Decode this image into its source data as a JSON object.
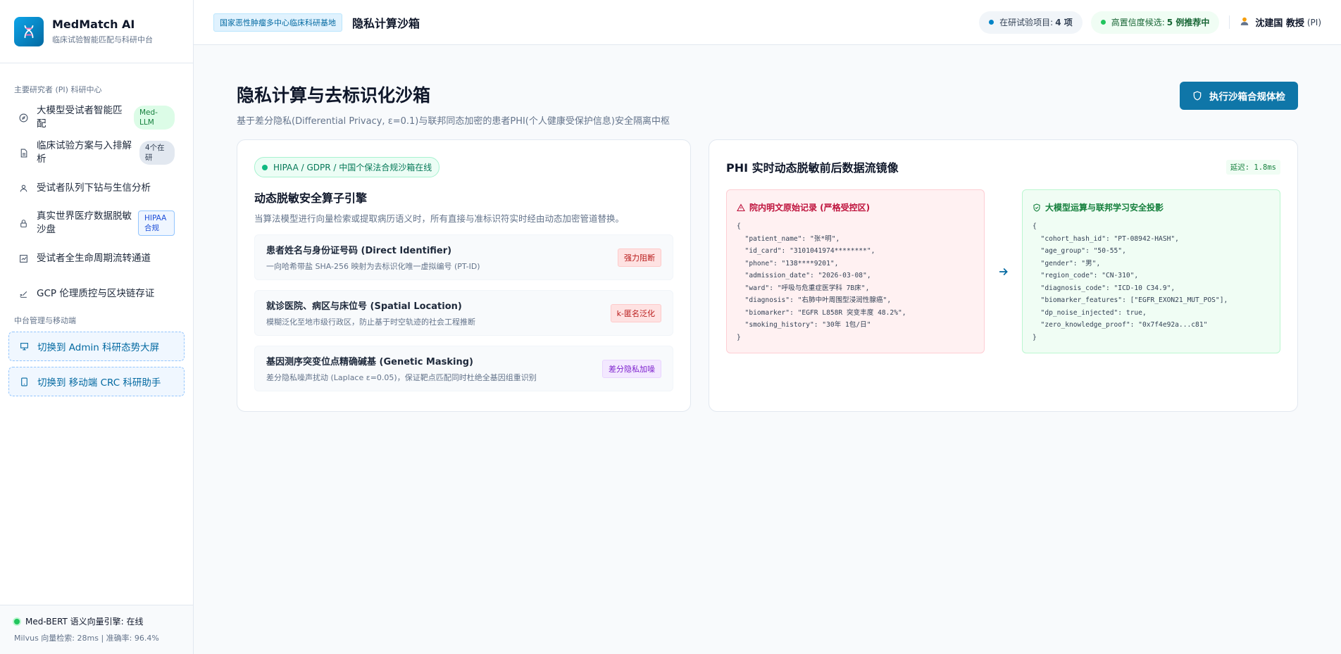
{
  "brand": {
    "name": "MedMatch AI",
    "subtitle": "临床试验智能匹配与科研中台"
  },
  "sidebar": {
    "section_pi": "主要研究者 (PI) 科研中心",
    "items": [
      {
        "label": "大模型受试者智能匹配",
        "badge": "Med-LLM",
        "icon": "compass-icon"
      },
      {
        "label": "临床试验方案与入排解析",
        "badge": "4个在研",
        "icon": "document-icon"
      },
      {
        "label": "受试者队列下钻与生信分析",
        "icon": "user-icon"
      },
      {
        "label": "真实世界医疗数据脱敏沙盘",
        "badge": "HIPAA合规",
        "icon": "lock-icon"
      },
      {
        "label": "受试者全生命周期流转通道",
        "icon": "chart-icon"
      },
      {
        "label": "GCP 伦理质控与区块链存证",
        "icon": "signature-icon"
      }
    ],
    "section_admin": "中台管理与移动端",
    "switches": [
      {
        "label": "切换到 Admin 科研态势大屏",
        "icon": "presentation-icon"
      },
      {
        "label": "切换到 移动端 CRC 科研助手",
        "icon": "tablet-icon"
      }
    ],
    "footer": {
      "status": "Med-BERT 语义向量引擎: 在线",
      "metrics": "Milvus 向量检索: 28ms | 准确率: 96.4%"
    }
  },
  "header": {
    "tag": "国家恶性肿瘤多中心临床科研基地",
    "title": "隐私计算沙箱",
    "projects_label": "在研试验项目:",
    "projects_value": "4 项",
    "candidates_label": "高置信度候选:",
    "candidates_value": "5 例推荐中",
    "user_name": "沈建国 教授",
    "user_role": "(PI)"
  },
  "page": {
    "title": "隐私计算与去标识化沙箱",
    "subtitle": "基于差分隐私(Differential Privacy, ε=0.1)与联邦同态加密的患者PHI(个人健康受保护信息)安全隔离中枢",
    "action_button": "执行沙箱合规体检"
  },
  "engine_card": {
    "badge": "HIPAA / GDPR / 中国个保法合规沙箱在线",
    "title": "动态脱敏安全算子引擎",
    "description": "当算法模型进行向量检索或提取病历语义时，所有直接与准标识符实时经由动态加密管道替换。",
    "rules": [
      {
        "title": "患者姓名与身份证号码 (Direct Identifier)",
        "desc": "一向哈希带盐 SHA-256 映射为去标识化唯一虚拟编号 (PT-ID)",
        "tag": "强力阻断",
        "tag_style": "red"
      },
      {
        "title": "就诊医院、病区与床位号 (Spatial Location)",
        "desc": "模糊泛化至地市级行政区，防止基于时空轨迹的社会工程推断",
        "tag": "k-匿名泛化",
        "tag_style": "red"
      },
      {
        "title": "基因测序突变位点精确碱基 (Genetic Masking)",
        "desc": "差分隐私噪声扰动 (Laplace ε=0.05)，保证靶点匹配同时杜绝全基因组重识别",
        "tag": "差分隐私加噪",
        "tag_style": "purple"
      }
    ]
  },
  "mirror_card": {
    "title": "PHI 实时动态脱敏前后数据流镜像",
    "latency": "延迟: 1.8ms",
    "raw_title": "院内明文原始记录 (严格受控区)",
    "raw_code": "{\n  \"patient_name\": \"张*明\",\n  \"id_card\": \"3101041974********\",\n  \"phone\": \"138****9201\",\n  \"admission_date\": \"2026-03-08\",\n  \"ward\": \"呼吸与危重症医学科 7B床\",\n  \"diagnosis\": \"右肺中叶周围型浸润性腺癌\",\n  \"biomarker\": \"EGFR L858R 突变丰度 48.2%\",\n  \"smoking_history\": \"30年 1包/日\"\n}",
    "safe_title": "大模型运算与联邦学习安全投影",
    "safe_code": "{\n  \"cohort_hash_id\": \"PT-08942-HASH\",\n  \"age_group\": \"50-55\",\n  \"gender\": \"男\",\n  \"region_code\": \"CN-310\",\n  \"diagnosis_code\": \"ICD-10 C34.9\",\n  \"biomarker_features\": [\"EGFR_EXON21_MUT_POS\"],\n  \"dp_noise_injected\": true,\n  \"zero_knowledge_proof\": \"0x7f4e92a...c81\"\n}"
  },
  "colors": {
    "accent": "#0f76a8",
    "success": "#22c55e",
    "danger": "#be123c"
  }
}
